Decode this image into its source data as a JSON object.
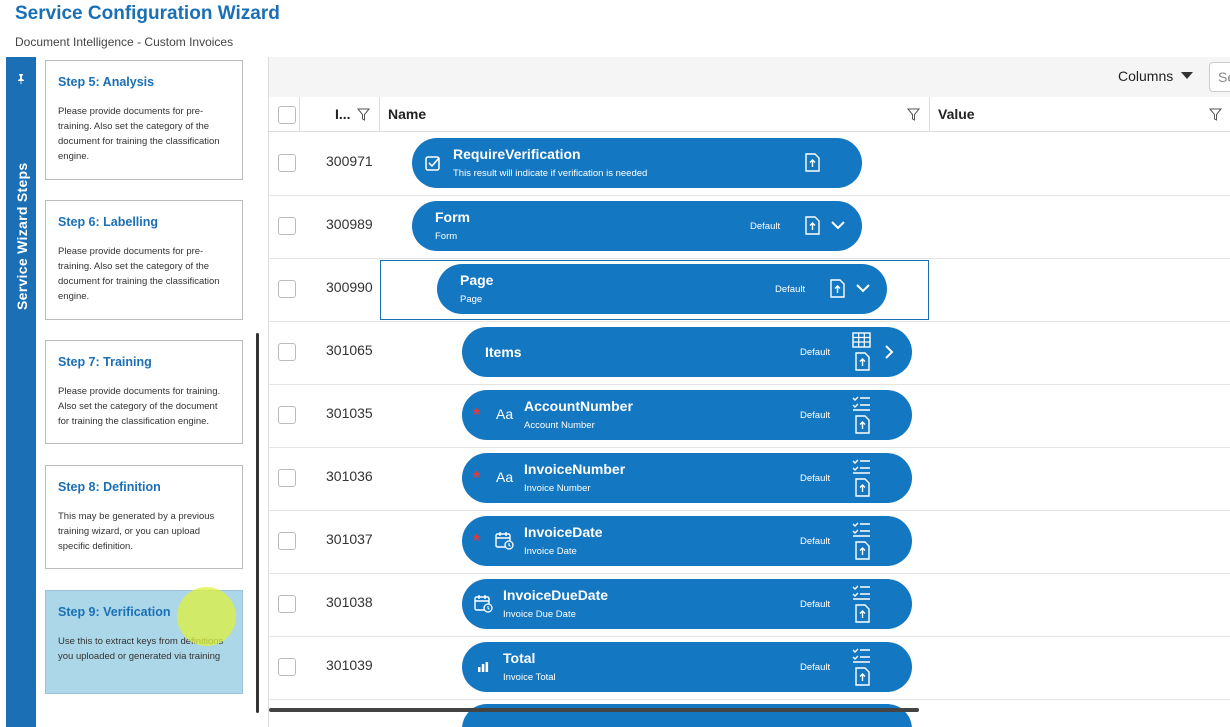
{
  "header": {
    "title": "Service Configuration Wizard",
    "subtitle": "Document Intelligence - Custom Invoices"
  },
  "side_tab": {
    "label": "Service Wizard Steps",
    "pin_icon": "pin-icon"
  },
  "steps": [
    {
      "title": "Step 5: Analysis",
      "desc": "Please provide documents for pre-training. Also set the category of the document for training the classification engine."
    },
    {
      "title": "Step 6: Labelling",
      "desc": "Please provide documents for pre-training. Also set the category of the document for training the classification engine."
    },
    {
      "title": "Step 7: Training",
      "desc": "Please provide documents for training. Also set the category of the document for training the classification engine."
    },
    {
      "title": "Step 8: Definition",
      "desc": "This may be generated by a previous training wizard, or you can upload specific definition."
    },
    {
      "title": "Step 9: Verification",
      "desc": "Use this to extract keys from definitions you uploaded or generated via training",
      "active": true
    }
  ],
  "toolbar": {
    "columns_label": "Columns",
    "search_placeholder": "Se"
  },
  "table": {
    "headers": {
      "id": "I...",
      "name": "Name",
      "value": "Value"
    },
    "rows": [
      {
        "id": "300971",
        "name": "RequireVerification",
        "desc": "This result will indicate if verification is needed",
        "default": "",
        "icon": "checkbox-icon"
      },
      {
        "id": "300989",
        "name": "Form",
        "desc": "Form",
        "default": "Default",
        "icon": ""
      },
      {
        "id": "300990",
        "name": "Page",
        "desc": "Page",
        "default": "Default",
        "icon": ""
      },
      {
        "id": "301065",
        "name": "Items",
        "desc": "",
        "default": "Default",
        "icon": "table-icon"
      },
      {
        "id": "301035",
        "name": "AccountNumber",
        "desc": "Account Number",
        "default": "Default",
        "icon": "text-aa-icon",
        "required": true
      },
      {
        "id": "301036",
        "name": "InvoiceNumber",
        "desc": "Invoice Number",
        "default": "Default",
        "icon": "text-aa-icon",
        "required": true
      },
      {
        "id": "301037",
        "name": "InvoiceDate",
        "desc": "Invoice Date",
        "default": "Default",
        "icon": "calendar-icon",
        "required": true
      },
      {
        "id": "301038",
        "name": "InvoiceDueDate",
        "desc": "Invoice Due Date",
        "default": "Default",
        "icon": "calendar-icon"
      },
      {
        "id": "301039",
        "name": "Total",
        "desc": "Invoice Total",
        "default": "Default",
        "icon": "chart-icon"
      }
    ],
    "required_marker": "*",
    "aa_glyph": "Aa"
  },
  "colors": {
    "brand": "#1a6fb5",
    "pill": "#1477c1",
    "active_step": "#acd7e8",
    "required": "#e23a3a"
  }
}
